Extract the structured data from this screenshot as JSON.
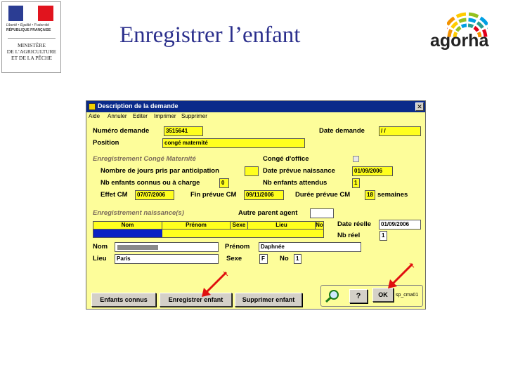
{
  "header": {
    "title": "Enregistrer l’enfant",
    "ministry_logo": {
      "motto": "Liberté • Égalité • Fraternité",
      "republic": "RÉPUBLIQUE FRANÇAISE",
      "ministry_lines": [
        "MINISTÈRE",
        "DE L’AGRICULTURE",
        "ET DE LA PÊCHE"
      ]
    },
    "brand_logo": {
      "text": "agorha",
      "arc_colors": [
        "#e2001a",
        "#f39200",
        "#ffcc00",
        "#95c11f",
        "#009fe3",
        "#2a9d8f"
      ]
    }
  },
  "window": {
    "title": "Description de la demande",
    "close_glyph": "✕",
    "menu": [
      "Aide",
      "Annuler",
      "Editer",
      "Imprimer",
      "Supprimer"
    ],
    "fields": {
      "numero_demande": {
        "label": "Numéro demande",
        "value": "3515641"
      },
      "date_demande": {
        "label": "Date demande",
        "value": "/ /"
      },
      "position": {
        "label": "Position",
        "value": "congé maternité"
      }
    },
    "conge_section": {
      "heading": "Enregistrement Congé Maternité",
      "conge_office": {
        "label": "Congé d'office",
        "checked": false
      },
      "nb_jours_anticipation": {
        "label": "Nombre de jours pris par anticipation",
        "value": ""
      },
      "date_prevue_naissance": {
        "label": "Date prévue naissance",
        "value": "01/09/2006"
      },
      "nb_enfants_charge": {
        "label": "Nb enfants connus ou à charge",
        "value": "0"
      },
      "nb_enfants_attendus": {
        "label": "Nb enfants attendus",
        "value": "1"
      },
      "effet_cm": {
        "label": "Effet CM",
        "value": "07/07/2006"
      },
      "fin_prevue_cm": {
        "label": "Fin prévue CM",
        "value": "09/11/2006"
      },
      "duree_prevue_cm": {
        "label": "Durée prévue CM",
        "value": "18",
        "unit": "semaines"
      }
    },
    "naissance_section": {
      "heading": "Enregistrement naissance(s)",
      "autre_parent": {
        "label": "Autre parent agent",
        "value": ""
      },
      "date_reelle": {
        "label": "Date réelle",
        "value": "01/09/2006"
      },
      "nb_reel": {
        "label": "Nb réel",
        "value": "1"
      },
      "grid_columns": [
        "Nom",
        "Prénom",
        "Sexe",
        "Lieu",
        "No"
      ]
    },
    "child": {
      "nom": {
        "label": "Nom",
        "value": ""
      },
      "prenom": {
        "label": "Prénom",
        "value": "Daphnée"
      },
      "lieu": {
        "label": "Lieu",
        "value": "Paris"
      },
      "sexe": {
        "label": "Sexe",
        "value": "F"
      },
      "no": {
        "label": "No",
        "value": "1"
      }
    },
    "buttons": {
      "enfants_connus": "Enfants connus",
      "enregistrer_enfant": "Enregistrer enfant",
      "supprimer_enfant": "Supprimer enfant",
      "help": "?",
      "ok": "OK"
    },
    "screen_code": "sp_cma01"
  },
  "colors": {
    "form_bg": "#fdfd9a",
    "field_bg": "#ffff1e",
    "titlebar": "#0a2a8a",
    "title_text": "#2b2f8c",
    "arrow": "#e01010"
  }
}
